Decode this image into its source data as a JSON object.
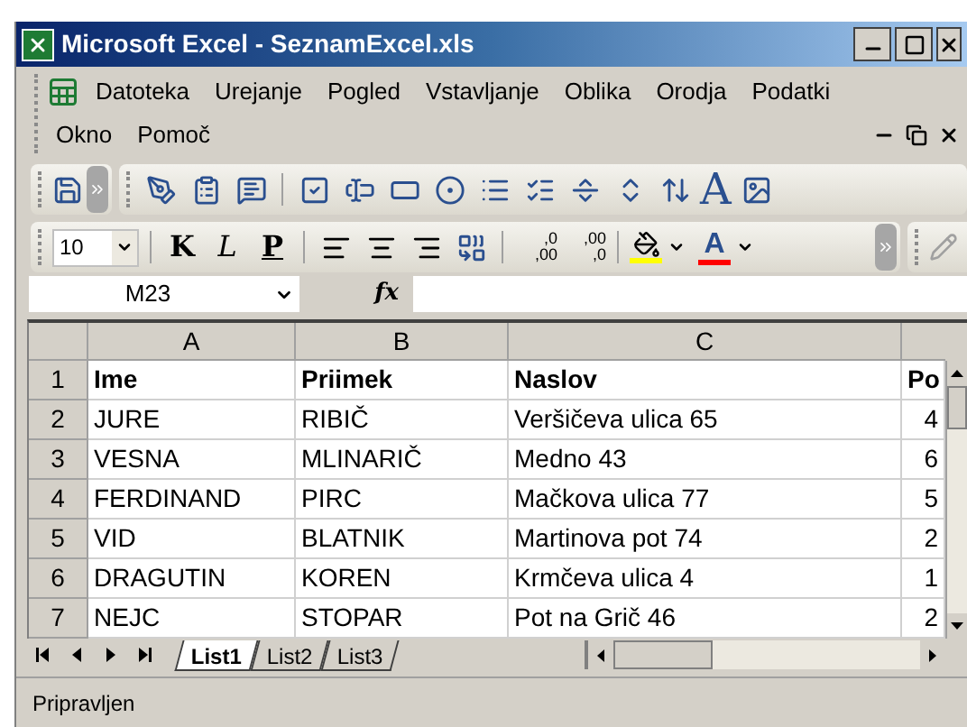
{
  "window": {
    "title": "Microsoft Excel - SeznamExcel.xls"
  },
  "menu_bar": {
    "items": [
      "Datoteka",
      "Urejanje",
      "Pogled",
      "Vstavljanje",
      "Oblika",
      "Orodja",
      "Podatki",
      "Okno",
      "Pomoč"
    ]
  },
  "forms_toolbar": {
    "wordart_label": "A"
  },
  "formatting_toolbar": {
    "font_size": "10",
    "style_buttons": [
      {
        "label": "K",
        "kind": "bold"
      },
      {
        "label": "L",
        "kind": "italic"
      },
      {
        "label": "P",
        "kind": "underline"
      }
    ],
    "decimal_buttons": [
      {
        "top": ",0",
        "bottom": ",00"
      },
      {
        "top": ",00",
        "bottom": ",0"
      }
    ],
    "font_color_label": "A"
  },
  "formula_bar": {
    "name_box": "M23",
    "fx_label": "fx"
  },
  "sheet": {
    "columns": [
      "A",
      "B",
      "C"
    ],
    "rows": [
      {
        "number": "1",
        "bold": true,
        "cells": [
          "Ime",
          "Priimek",
          "Naslov",
          "Po"
        ]
      },
      {
        "number": "2",
        "bold": false,
        "cells": [
          "JURE",
          "RIBIČ",
          "Veršičeva ulica 65",
          "4"
        ]
      },
      {
        "number": "3",
        "bold": false,
        "cells": [
          "VESNA",
          "MLINARIČ",
          "Medno 43",
          "6"
        ]
      },
      {
        "number": "4",
        "bold": false,
        "cells": [
          "FERDINAND",
          "PIRC",
          "Mačkova ulica 77",
          "5"
        ]
      },
      {
        "number": "5",
        "bold": false,
        "cells": [
          "VID",
          "BLATNIK",
          "Martinova pot 74",
          "2"
        ]
      },
      {
        "number": "6",
        "bold": false,
        "cells": [
          "DRAGUTIN",
          "KOREN",
          "Krmčeva ulica 4",
          "1"
        ]
      },
      {
        "number": "7",
        "bold": false,
        "cells": [
          "NEJC",
          "STOPAR",
          "Pot na Grič 46",
          "2"
        ]
      }
    ]
  },
  "sheet_tabs": [
    {
      "label": "List1",
      "selected": true
    },
    {
      "label": "List2",
      "selected": false
    },
    {
      "label": "List3",
      "selected": false
    }
  ],
  "status_bar": {
    "text": "Pripravljen"
  }
}
